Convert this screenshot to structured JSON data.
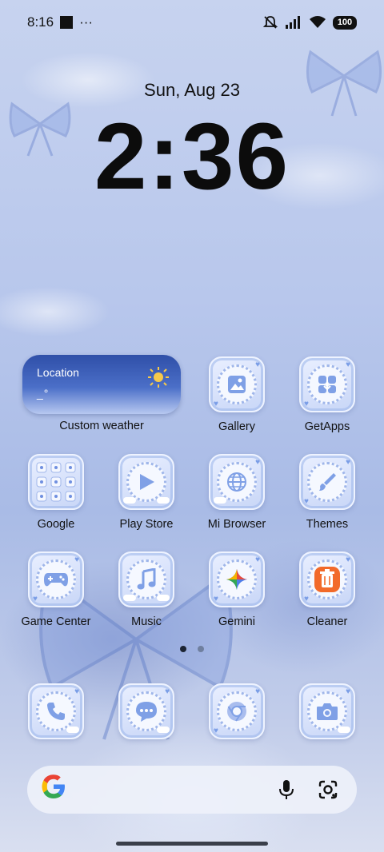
{
  "status": {
    "time": "8:16",
    "more": "···",
    "battery": "100"
  },
  "lockscreen": {
    "date": "Sun, Aug 23",
    "time": "2:36"
  },
  "weather": {
    "location": "Location",
    "temperature": "_°",
    "label": "Custom weather"
  },
  "apps": [
    {
      "label": "Gallery",
      "icon": "gallery-icon"
    },
    {
      "label": "GetApps",
      "icon": "getapps-icon"
    },
    {
      "label": "Google",
      "icon": "google-folder-icon"
    },
    {
      "label": "Play Store",
      "icon": "play-store-icon"
    },
    {
      "label": "Mi Browser",
      "icon": "browser-globe-icon"
    },
    {
      "label": "Themes",
      "icon": "themes-brush-icon"
    },
    {
      "label": "Game Center",
      "icon": "gamepad-icon"
    },
    {
      "label": "Music",
      "icon": "music-note-icon"
    },
    {
      "label": "Gemini",
      "icon": "gemini-star-icon"
    },
    {
      "label": "Cleaner",
      "icon": "cleaner-trash-icon"
    }
  ],
  "dock": [
    {
      "icon": "phone-icon"
    },
    {
      "icon": "messages-icon"
    },
    {
      "icon": "chrome-icon"
    },
    {
      "icon": "camera-icon"
    }
  ],
  "pager": {
    "pages": 2,
    "active": 1
  },
  "colors": {
    "accent": "#6f8fe0",
    "text": "#111111",
    "weather_top": "#2f4fa8"
  }
}
